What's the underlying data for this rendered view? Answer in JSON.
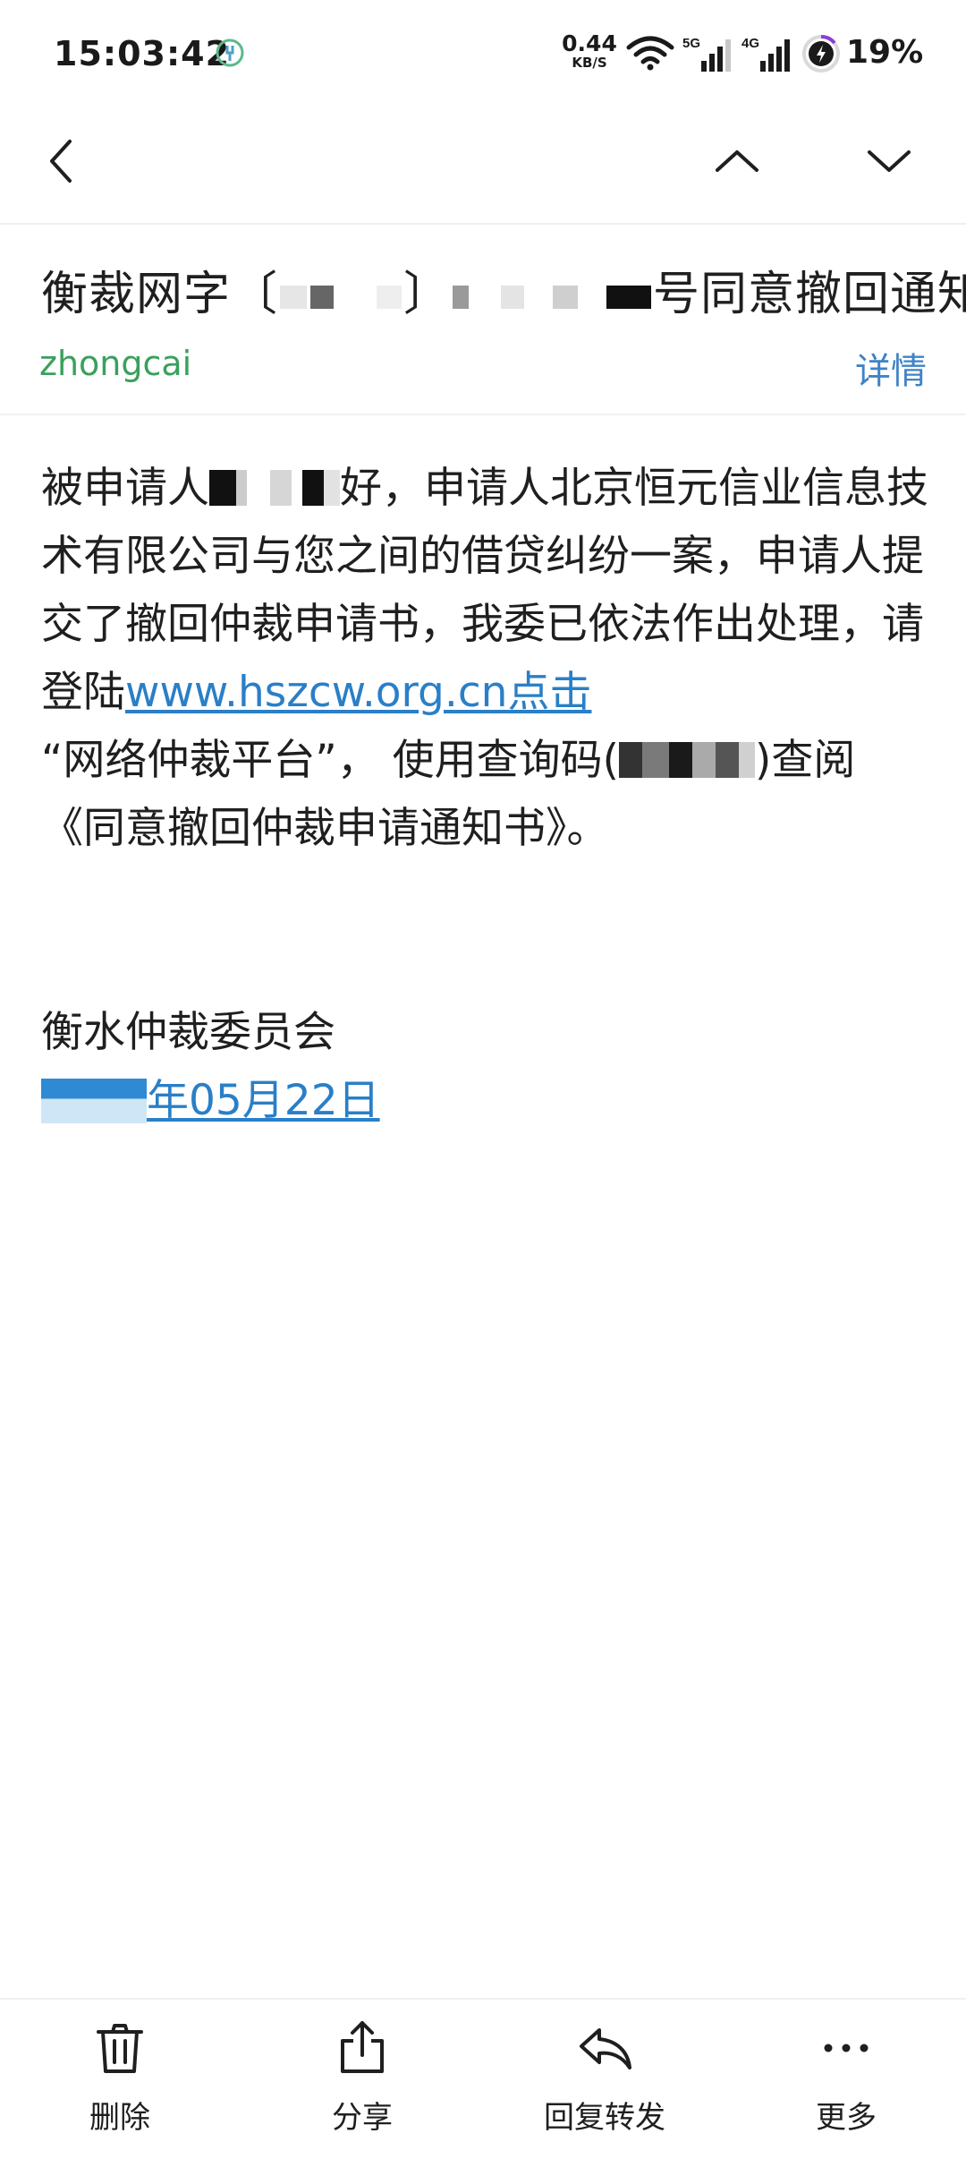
{
  "status_bar": {
    "time": "15:03:42",
    "net_speed_value": "0.44",
    "net_speed_unit": "KB/S",
    "signal1_label": "5G",
    "signal2_label": "4G",
    "battery": "19%"
  },
  "nav": {
    "back_icon": "back-chevron-icon",
    "prev_icon": "chevron-up-icon",
    "next_icon": "chevron-down-icon"
  },
  "mail": {
    "subject_prefix": "衡裁网字〔",
    "subject_mid": "〕",
    "subject_suffix": "号同意撤回通知",
    "sender": "zhongcai",
    "details_label": "详情",
    "body_p1_a": "被申请人",
    "body_p1_b": "好，申请人北京恒元信业信息技术有限公司与您之间的借贷纠纷一案，申请人提交了撤回仲裁申请书，我委已依法作出处理，请登陆",
    "body_link": "www.hszcw.org.cn点击",
    "body_p1_c": "“网络仲裁平台”， 使用查询码(",
    "body_p1_d": ")查阅《同意撤回仲裁申请通知书》。",
    "signature": "衡水仲裁委员会",
    "date_suffix": "年05月22日"
  },
  "bottom_bar": {
    "delete_label": "删除",
    "share_label": "分享",
    "reply_forward_label": "回复转发",
    "more_label": "更多"
  },
  "colors": {
    "sender": "#3aa05c",
    "details_link": "#3f83c6",
    "body_link": "#2a7fc7",
    "text": "#1f1f1f"
  }
}
